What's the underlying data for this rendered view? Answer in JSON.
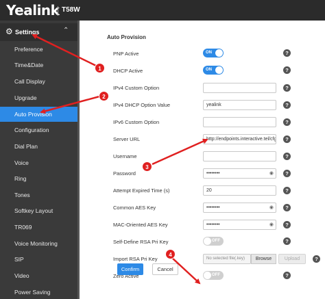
{
  "header": {
    "brand": "Yealink",
    "model": "T58W"
  },
  "sidebar": {
    "section": "Settings",
    "items": [
      {
        "label": "Preference"
      },
      {
        "label": "Time&Date"
      },
      {
        "label": "Call Display"
      },
      {
        "label": "Upgrade"
      },
      {
        "label": "Auto Provision",
        "active": true
      },
      {
        "label": "Configuration"
      },
      {
        "label": "Dial Plan"
      },
      {
        "label": "Voice"
      },
      {
        "label": "Ring"
      },
      {
        "label": "Tones"
      },
      {
        "label": "Softkey Layout"
      },
      {
        "label": "TR069"
      },
      {
        "label": "Voice Monitoring"
      },
      {
        "label": "SIP"
      },
      {
        "label": "Video"
      },
      {
        "label": "Power Saving"
      }
    ]
  },
  "main": {
    "title": "Auto Provision",
    "rows": {
      "pnp": {
        "label": "PNP Active",
        "toggle": "ON"
      },
      "dhcp": {
        "label": "DHCP Active",
        "toggle": "ON"
      },
      "ipv4_custom": {
        "label": "IPv4 Custom Option",
        "value": ""
      },
      "ipv4_dhcp": {
        "label": "IPv4 DHCP Option Value",
        "value": "yealink"
      },
      "ipv6_custom": {
        "label": "IPv6 Custom Option",
        "value": ""
      },
      "server_url": {
        "label": "Server URL",
        "value": "http://endpoints.interactive.tel/cfg"
      },
      "username": {
        "label": "Username",
        "value": ""
      },
      "password": {
        "label": "Password",
        "value": "••••••••"
      },
      "attempt_time": {
        "label": "Attempt Expired Time (s)",
        "value": "20"
      },
      "common_aes": {
        "label": "Common AES Key",
        "value": "••••••••"
      },
      "mac_aes": {
        "label": "MAC-Oriented AES Key",
        "value": "••••••••"
      },
      "self_define_rsa": {
        "label": "Self-Define RSA Pri Key",
        "toggle": "OFF"
      },
      "import_rsa": {
        "label": "Import RSA Pri Key",
        "file_placeholder": "No selected file(.key)",
        "browse": "Browse",
        "upload": "Upload"
      },
      "zero": {
        "label": "Zero Active",
        "toggle": "OFF"
      }
    },
    "help_glyph": "?",
    "confirm": "Confirm",
    "cancel": "Cancel"
  },
  "callouts": [
    "1",
    "2",
    "3",
    "4"
  ],
  "icons": {
    "settings": "gear-icon",
    "collapse": "chevron-up-icon",
    "help": "help-icon",
    "reveal": "eye-icon"
  },
  "colors": {
    "accent": "#2d8ae6",
    "sidebar": "#3a3a3a",
    "topbar": "#2b2b2b",
    "callout": "#e02020"
  }
}
